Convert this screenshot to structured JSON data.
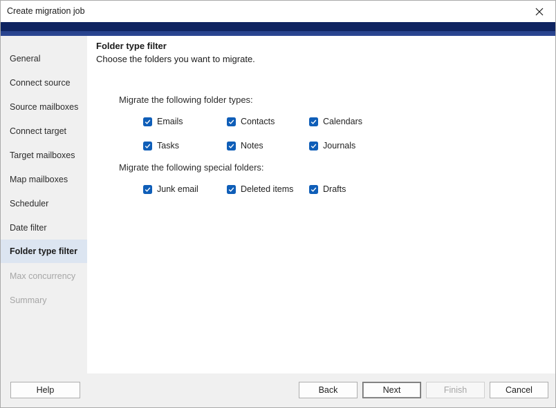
{
  "window": {
    "title": "Create migration job",
    "banner_color": "#0f2461"
  },
  "sidebar": {
    "items": [
      {
        "label": "General",
        "state": "normal"
      },
      {
        "label": "Connect source",
        "state": "normal"
      },
      {
        "label": "Source mailboxes",
        "state": "normal"
      },
      {
        "label": "Connect target",
        "state": "normal"
      },
      {
        "label": "Target mailboxes",
        "state": "normal"
      },
      {
        "label": "Map mailboxes",
        "state": "normal"
      },
      {
        "label": "Scheduler",
        "state": "normal"
      },
      {
        "label": "Date filter",
        "state": "normal"
      },
      {
        "label": "Folder type filter",
        "state": "active"
      },
      {
        "label": "Max concurrency",
        "state": "disabled"
      },
      {
        "label": "Summary",
        "state": "disabled"
      }
    ]
  },
  "content": {
    "heading": "Folder type filter",
    "subheading": "Choose the folders you want to migrate.",
    "folder_types_label": "Migrate the following folder types:",
    "folder_types": [
      {
        "label": "Emails",
        "checked": true
      },
      {
        "label": "Contacts",
        "checked": true
      },
      {
        "label": "Calendars",
        "checked": true
      },
      {
        "label": "Tasks",
        "checked": true
      },
      {
        "label": "Notes",
        "checked": true
      },
      {
        "label": "Journals",
        "checked": true
      }
    ],
    "special_folders_label": "Migrate the following special folders:",
    "special_folders": [
      {
        "label": "Junk email",
        "checked": true
      },
      {
        "label": "Deleted items",
        "checked": true
      },
      {
        "label": "Drafts",
        "checked": true
      }
    ],
    "checkbox_color": "#0f5eb8"
  },
  "footer": {
    "help": "Help",
    "back": "Back",
    "next": "Next",
    "finish": "Finish",
    "cancel": "Cancel"
  }
}
